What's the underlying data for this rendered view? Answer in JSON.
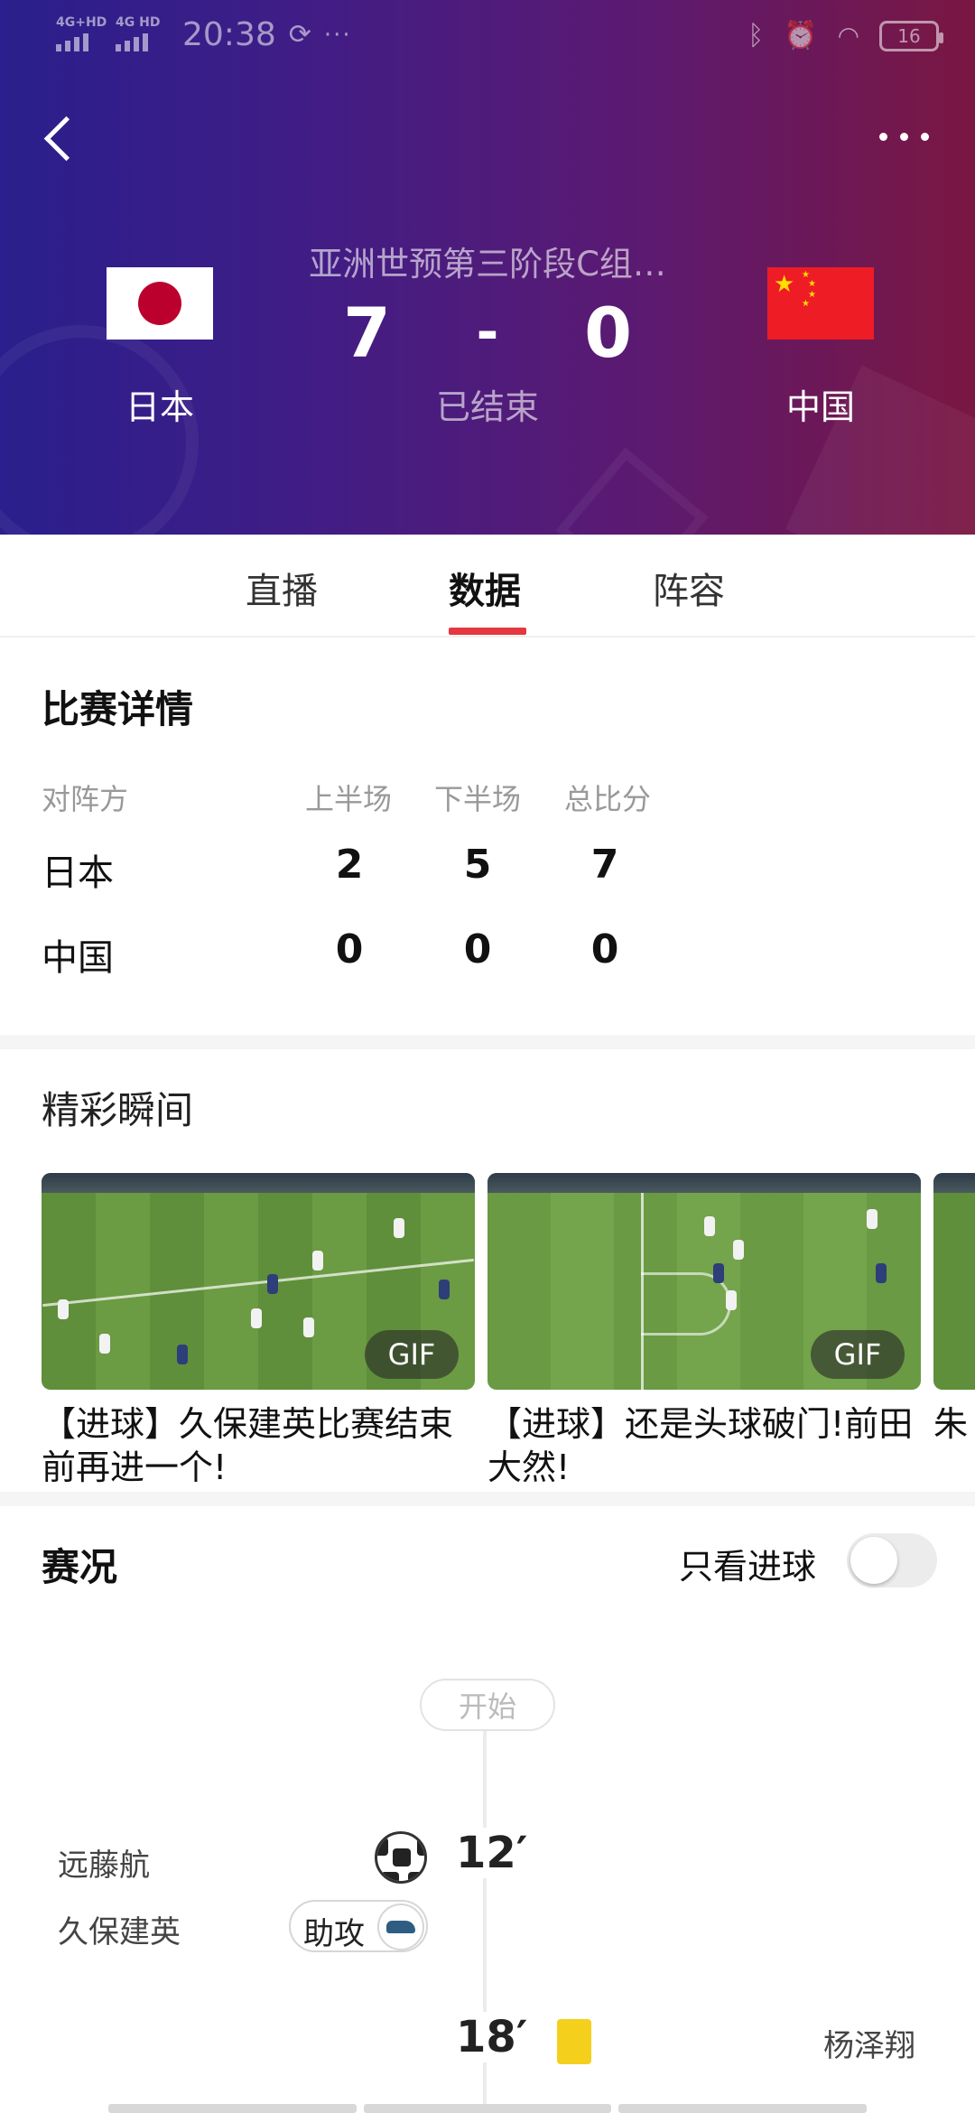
{
  "statusbar": {
    "net1": "4G+HD",
    "net2": "4G HD",
    "time": "20:38",
    "dots": "···",
    "bluetooth_icon": "bluetooth-icon",
    "alarm_icon": "alarm-icon",
    "wifi_icon": "wifi-icon",
    "battery": "16"
  },
  "header": {
    "match_title": "亚洲世预第三阶段C组…",
    "home": {
      "name": "日本",
      "score": "7",
      "flag_icon": "japan-flag-icon"
    },
    "away": {
      "name": "中国",
      "score": "0",
      "flag_icon": "china-flag-icon"
    },
    "dash": "-",
    "status": "已结束"
  },
  "tabs": [
    {
      "label": "直播",
      "active": false
    },
    {
      "label": "数据",
      "active": true
    },
    {
      "label": "阵容",
      "active": false
    }
  ],
  "details": {
    "title": "比赛详情",
    "headers": [
      "对阵方",
      "上半场",
      "下半场",
      "总比分"
    ],
    "rows": [
      {
        "team": "日本",
        "first": "2",
        "second": "5",
        "total": "7"
      },
      {
        "team": "中国",
        "first": "0",
        "second": "0",
        "total": "0"
      }
    ]
  },
  "highlights": {
    "title": "精彩瞬间",
    "items": [
      {
        "title": "【进球】久保建英比赛结束前再进一个!",
        "badge": "GIF"
      },
      {
        "title": "【进球】还是头球破门!前田大然!",
        "badge": "GIF"
      },
      {
        "title": "朱"
      }
    ]
  },
  "timeline": {
    "title": "赛况",
    "filter_label": "只看进球",
    "filter_on": false,
    "start_label": "开始",
    "events": [
      {
        "minute": "12′",
        "player": "远藤航",
        "type": "goal",
        "icon": "soccer-ball-icon"
      },
      {
        "player": "久保建英",
        "type": "assist",
        "label": "助攻",
        "icon": "boot-icon"
      },
      {
        "minute": "18′",
        "player": "杨泽翔",
        "type": "yellow-card",
        "icon": "yellow-card-icon"
      }
    ]
  },
  "colors": {
    "accent": "#e5373f",
    "header_gradient_start": "#2a1f8c",
    "header_gradient_end": "#7a1742",
    "yellow_card": "#f4d01d"
  }
}
